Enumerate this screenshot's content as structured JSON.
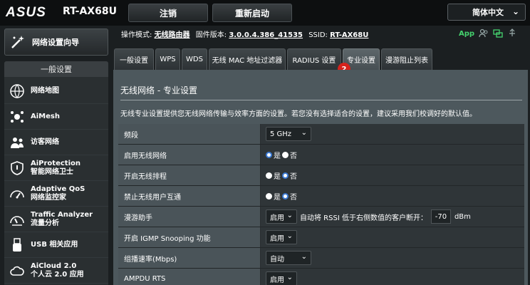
{
  "header": {
    "brand": "ASUS",
    "model": "RT-AX68U",
    "logout_label": "注销",
    "reboot_label": "重新启动",
    "language": "简体中文"
  },
  "status": {
    "mode_label": "操作模式:",
    "mode_value": "无线路由器",
    "firmware_label": "固件版本:",
    "firmware_value": "3.0.0.4.386_41535",
    "ssid_label": "SSID:",
    "ssid_value": "RT-AX68U",
    "app_label": "App"
  },
  "sidebar": {
    "setup_wizard": "网络设置向导",
    "section_title": "一般设置",
    "items": [
      {
        "label": "网络地图",
        "icon": "network-map-icon"
      },
      {
        "label": "AiMesh",
        "icon": "aimesh-icon"
      },
      {
        "label": "访客网络",
        "icon": "guest-network-icon"
      },
      {
        "label": "AiProtection",
        "sub": "智能网络卫士",
        "icon": "shield-icon"
      },
      {
        "label": "Adaptive QoS",
        "sub": "网络监控家",
        "icon": "gauge-icon"
      },
      {
        "label": "Traffic Analyzer",
        "sub": "流量分析",
        "icon": "analyzer-icon"
      },
      {
        "label": "USB 相关应用",
        "icon": "usb-icon"
      },
      {
        "label": "AiCloud 2.0",
        "sub": "个人云 2.0 应用",
        "icon": "cloud-icon"
      }
    ]
  },
  "tabs": [
    {
      "label": "一般设置"
    },
    {
      "label": "WPS"
    },
    {
      "label": "WDS"
    },
    {
      "label": "无线 MAC 地址过滤器"
    },
    {
      "label": "RADIUS 设置"
    },
    {
      "label": "专业设置"
    },
    {
      "label": "漫游阻止列表"
    }
  ],
  "annotation_badge": "2",
  "content": {
    "title": "无线网络 - 专业设置",
    "description": "无线专业设置提供您无线网络传输与效率方面的设置。若您没有选择适合的设置，建议采用我们校调好的默认值。",
    "rows": {
      "band": {
        "label": "频段",
        "value": "5 GHz"
      },
      "enable_radio": {
        "label": "启用无线网络",
        "yes": "是",
        "no": "否",
        "selected": "yes"
      },
      "schedule": {
        "label": "开启无线排程",
        "yes": "是",
        "no": "否",
        "selected": "no"
      },
      "isolation": {
        "label": "禁止无线用户互通",
        "yes": "是",
        "no": "否",
        "selected": "no"
      },
      "roaming": {
        "label": "漫游助手",
        "select": "启用",
        "text_before": "自动将 RSSI 低于右侧数值的客户断开：",
        "rssi": "-70",
        "unit": "dBm"
      },
      "igmp": {
        "label": "开启 IGMP Snooping 功能",
        "select": "启用"
      },
      "multicast": {
        "label": "组播速率(Mbps)",
        "select": "自动"
      },
      "ampdu": {
        "label": "AMPDU RTS",
        "select": "启用"
      }
    }
  },
  "colors": {
    "background": "#1b1f21",
    "content_bg": "#4d585d",
    "radio_accent": "#3d7bd4",
    "badge": "#d6221c",
    "app_green": "#45d26e"
  }
}
